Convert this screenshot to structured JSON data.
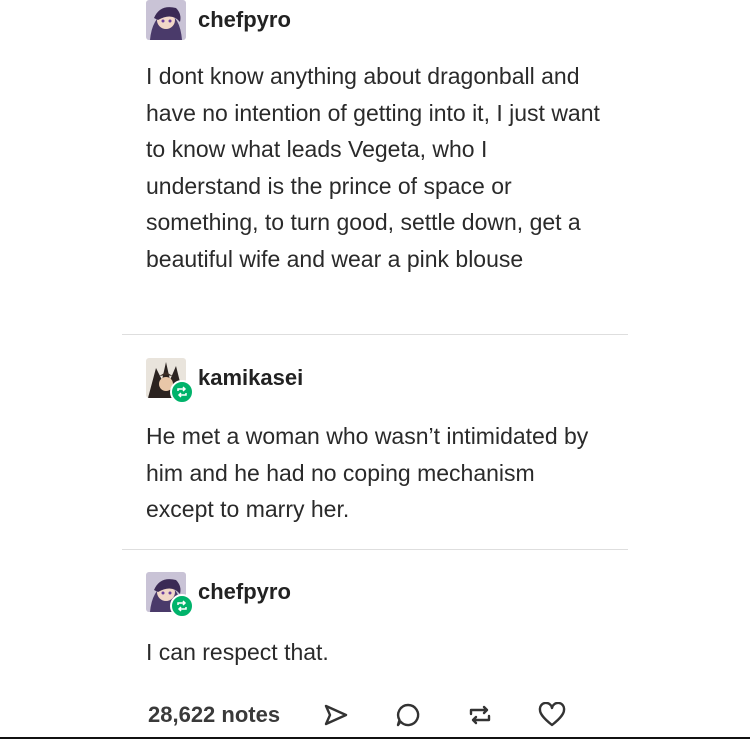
{
  "posts": [
    {
      "username": "chefpyro",
      "text": "I dont know anything about dragonball and have no intention of getting into it, I just want to know what leads Vegeta, who I understand is the prince of space or something, to turn good, settle down, get a beautiful wife and wear a pink blouse"
    },
    {
      "username": "kamikasei",
      "text": "He met a woman who wasn’t intimidated by him and he had no coping mechanism except to marry her."
    },
    {
      "username": "chefpyro",
      "text": "I can respect that."
    }
  ],
  "footer": {
    "notes": "28,622 notes",
    "icons": [
      "share-icon",
      "reply-icon",
      "reblog-icon",
      "like-icon"
    ]
  },
  "colors": {
    "reblog_badge": "#00b36b",
    "divider": "#dedede",
    "text": "#2a2a2a"
  }
}
